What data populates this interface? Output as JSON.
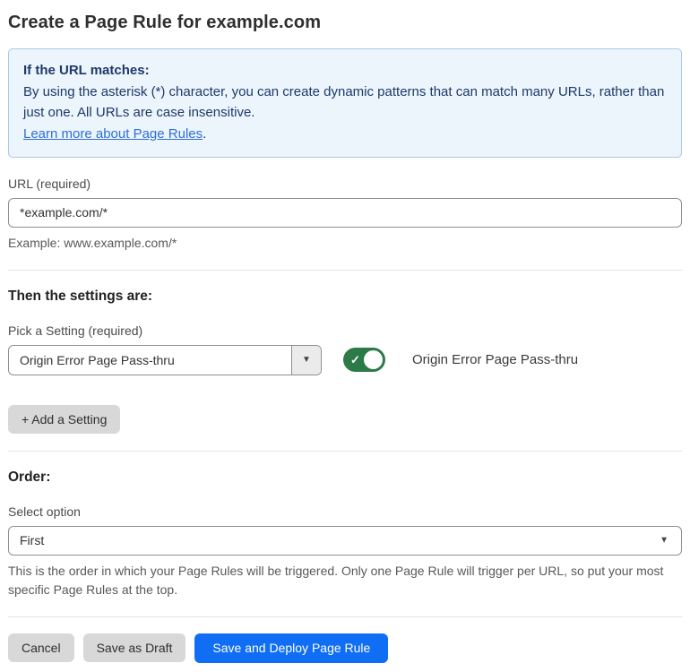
{
  "page": {
    "title": "Create a Page Rule for example.com"
  },
  "info_box": {
    "heading": "If the URL matches:",
    "body": "By using the asterisk (*) character, you can create dynamic patterns that can match many URLs, rather than just one. All URLs are case insensitive.",
    "link_text": "Learn more about Page Rules",
    "link_suffix": "."
  },
  "url_field": {
    "label": "URL (required)",
    "value": "*example.com/*",
    "helper": "Example: www.example.com/*"
  },
  "settings_section": {
    "heading": "Then the settings are:",
    "picker_label": "Pick a Setting (required)",
    "picker_value": "Origin Error Page Pass-thru",
    "toggle_state": "on",
    "toggle_label": "Origin Error Page Pass-thru",
    "add_setting_label": "+ Add a Setting"
  },
  "order_section": {
    "heading": "Order:",
    "select_label": "Select option",
    "select_value": "First",
    "helper": "This is the order in which your Page Rules will be triggered. Only one Page Rule will trigger per URL, so put your most specific Page Rules at the top."
  },
  "footer": {
    "cancel_label": "Cancel",
    "save_draft_label": "Save as Draft",
    "save_deploy_label": "Save and Deploy Page Rule"
  },
  "icons": {
    "dropdown_arrow": "▼",
    "checkmark": "✓"
  },
  "colors": {
    "accent_blue": "#0f6ef4",
    "toggle_green": "#2c7a47",
    "info_background": "#ecf4fc",
    "info_border": "#a9c9ec",
    "info_text": "#1e3a68",
    "link_blue": "#2f6fd6"
  }
}
